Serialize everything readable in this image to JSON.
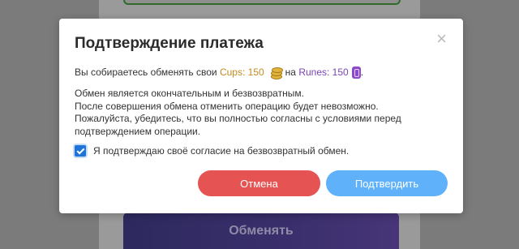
{
  "background": {
    "exchange_button_label": "Обменять"
  },
  "modal": {
    "title": "Подтверждение платежа",
    "close_symbol": "×",
    "line1": {
      "prefix": "Вы собираетесь обменять свои",
      "cups": "Cups: 150",
      "middle": "на",
      "runes": "Runes: 150",
      "suffix": "."
    },
    "info_lines": [
      "Обмен является окончательным и безвозвратным.",
      "После совершения обмена отменить операцию будет невозможно.",
      "Пожалуйста, убедитесь, что вы полностью согласны с условиями перед",
      "подтверждением операции."
    ],
    "confirm_label": "Я подтверждаю своё согласие на безвозвратный обмен.",
    "confirm_checked": true,
    "cancel_label": "Отмена",
    "confirm_button_label": "Подтвердить"
  },
  "colors": {
    "cups": "#c58a1d",
    "runes": "#7a43b6",
    "cancel": "#e55353",
    "confirm": "#5fb2f9"
  }
}
